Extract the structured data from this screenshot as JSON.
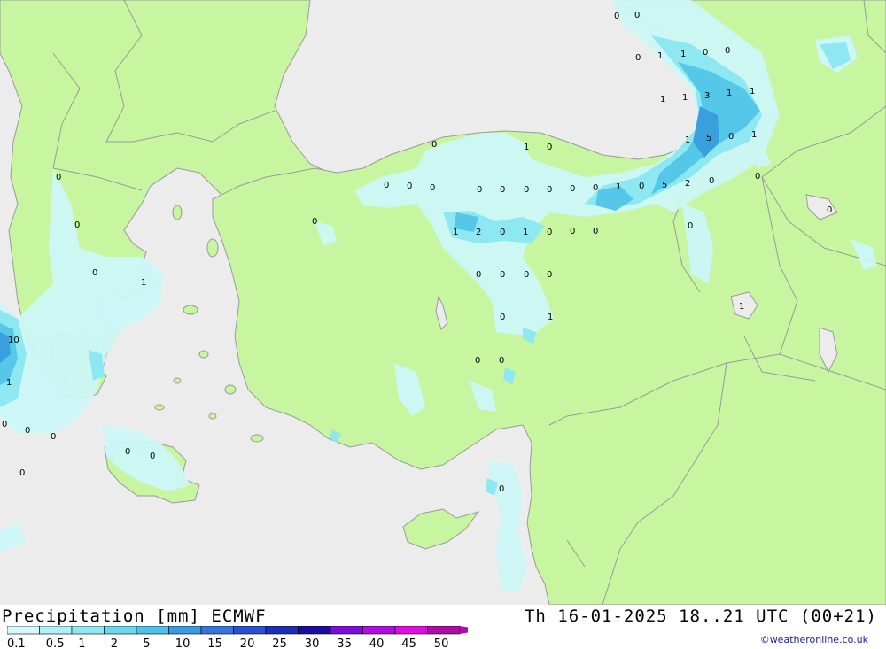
{
  "header": {
    "title": "Precipitation [mm] ECMWF",
    "datetime": "Th 16-01-2025 18..21 UTC (00+21)",
    "credit": "©weatheronline.co.uk"
  },
  "colors": {
    "land": "#c8f5a0",
    "sea": "#ececec",
    "border": "#9a9a9a",
    "precip_light": "#ccf7f7",
    "precip_mid": "#8ee8f2",
    "precip_heavy": "#55c8ea",
    "precip_core": "#3aa0dd"
  },
  "legend": {
    "levels": [
      "0.1",
      "0.5",
      "1",
      "2",
      "5",
      "10",
      "15",
      "20",
      "25",
      "30",
      "35",
      "40",
      "45",
      "50"
    ],
    "colors": [
      "#d6f9fb",
      "#aef0f7",
      "#8ee8f2",
      "#6cd8ee",
      "#4cc3ea",
      "#3a9be0",
      "#3575dc",
      "#2a4fcf",
      "#1a2eb8",
      "#1a0ca0",
      "#7a0cdc",
      "#b20ce0",
      "#e00ce0",
      "#b00ca8"
    ]
  },
  "values": [
    {
      "t": "0"
    },
    {
      "t": "0"
    },
    {
      "t": "0"
    },
    {
      "t": "1"
    },
    {
      "t": "1"
    },
    {
      "t": "0"
    },
    {
      "t": "0"
    },
    {
      "t": "1"
    },
    {
      "t": "1"
    },
    {
      "t": "3"
    },
    {
      "t": "1"
    },
    {
      "t": "1"
    },
    {
      "t": "0"
    },
    {
      "t": "1"
    },
    {
      "t": "0"
    },
    {
      "t": "1"
    },
    {
      "t": "5"
    },
    {
      "t": "0"
    },
    {
      "t": "1"
    },
    {
      "t": "0"
    },
    {
      "t": "0"
    },
    {
      "t": "0"
    },
    {
      "t": "0"
    },
    {
      "t": "0"
    },
    {
      "t": "0"
    },
    {
      "t": "0"
    },
    {
      "t": "0"
    },
    {
      "t": "0"
    },
    {
      "t": "1"
    },
    {
      "t": "0"
    },
    {
      "t": "5"
    },
    {
      "t": "2"
    },
    {
      "t": "0"
    },
    {
      "t": "0"
    },
    {
      "t": "0"
    },
    {
      "t": "1"
    },
    {
      "t": "2"
    },
    {
      "t": "0"
    },
    {
      "t": "1"
    },
    {
      "t": "0"
    },
    {
      "t": "0"
    },
    {
      "t": "0"
    },
    {
      "t": "0"
    },
    {
      "t": "0"
    },
    {
      "t": "0"
    },
    {
      "t": "0"
    },
    {
      "t": "0"
    },
    {
      "t": "0"
    },
    {
      "t": "0"
    },
    {
      "t": "1"
    },
    {
      "t": "1"
    },
    {
      "t": "0"
    },
    {
      "t": "1"
    },
    {
      "t": "0"
    },
    {
      "t": "0"
    },
    {
      "t": "10"
    },
    {
      "t": "1"
    },
    {
      "t": "0"
    },
    {
      "t": "0"
    },
    {
      "t": "0"
    },
    {
      "t": "0"
    },
    {
      "t": "0"
    },
    {
      "t": "0"
    },
    {
      "t": "0"
    },
    {
      "t": "0"
    },
    {
      "t": "0"
    }
  ]
}
